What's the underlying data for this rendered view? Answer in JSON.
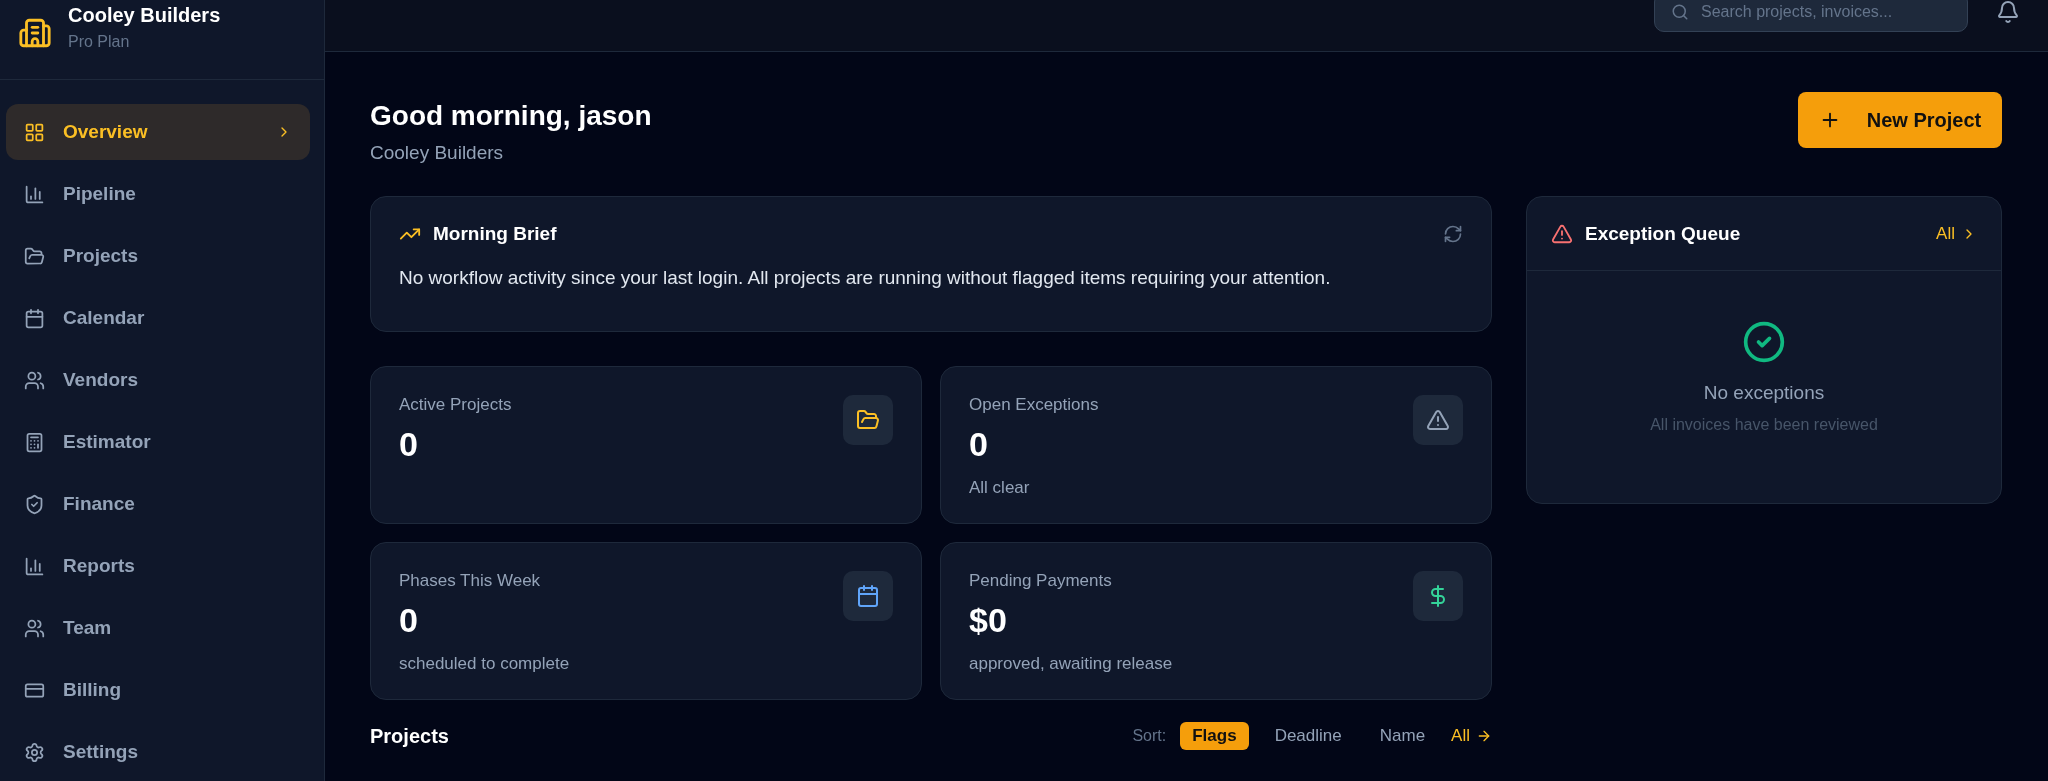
{
  "sidebar": {
    "company": "Cooley Builders",
    "plan": "Pro Plan",
    "items": [
      {
        "label": "Overview",
        "selected": true
      },
      {
        "label": "Pipeline",
        "selected": false
      },
      {
        "label": "Projects",
        "selected": false
      },
      {
        "label": "Calendar",
        "selected": false
      },
      {
        "label": "Vendors",
        "selected": false
      },
      {
        "label": "Estimator",
        "selected": false
      },
      {
        "label": "Finance",
        "selected": false
      },
      {
        "label": "Reports",
        "selected": false
      },
      {
        "label": "Team",
        "selected": false
      },
      {
        "label": "Billing",
        "selected": false
      },
      {
        "label": "Settings",
        "selected": false
      }
    ]
  },
  "topbar": {
    "search": {
      "placeholder": "Search projects, invoices..."
    }
  },
  "header": {
    "greeting": "Good morning, jason",
    "subtitle": "Cooley Builders",
    "new_button": "New Project"
  },
  "brief": {
    "title": "Morning Brief",
    "text": "No workflow activity since your last login. All projects are running without flagged items requiring your attention."
  },
  "stats": [
    {
      "label": "Active Projects",
      "value": "0"
    },
    {
      "label": "Open Exceptions",
      "value": "0",
      "note": "All clear"
    },
    {
      "label": "Phases This Week",
      "value": "0",
      "note": "scheduled to complete"
    },
    {
      "label": "Pending Payments",
      "value": "$0",
      "note": "approved, awaiting release"
    }
  ],
  "exceptions": {
    "title": "Exception Queue",
    "link": "All",
    "empty_title": "No exceptions",
    "empty_text": "All invoices have been reviewed"
  },
  "projects": {
    "title": "Projects",
    "sort_label": "Sort:",
    "sort_options": [
      {
        "label": "Flags",
        "selected": true
      },
      {
        "label": "Deadline",
        "selected": false
      },
      {
        "label": "Name",
        "selected": false
      }
    ],
    "link": "All"
  }
}
